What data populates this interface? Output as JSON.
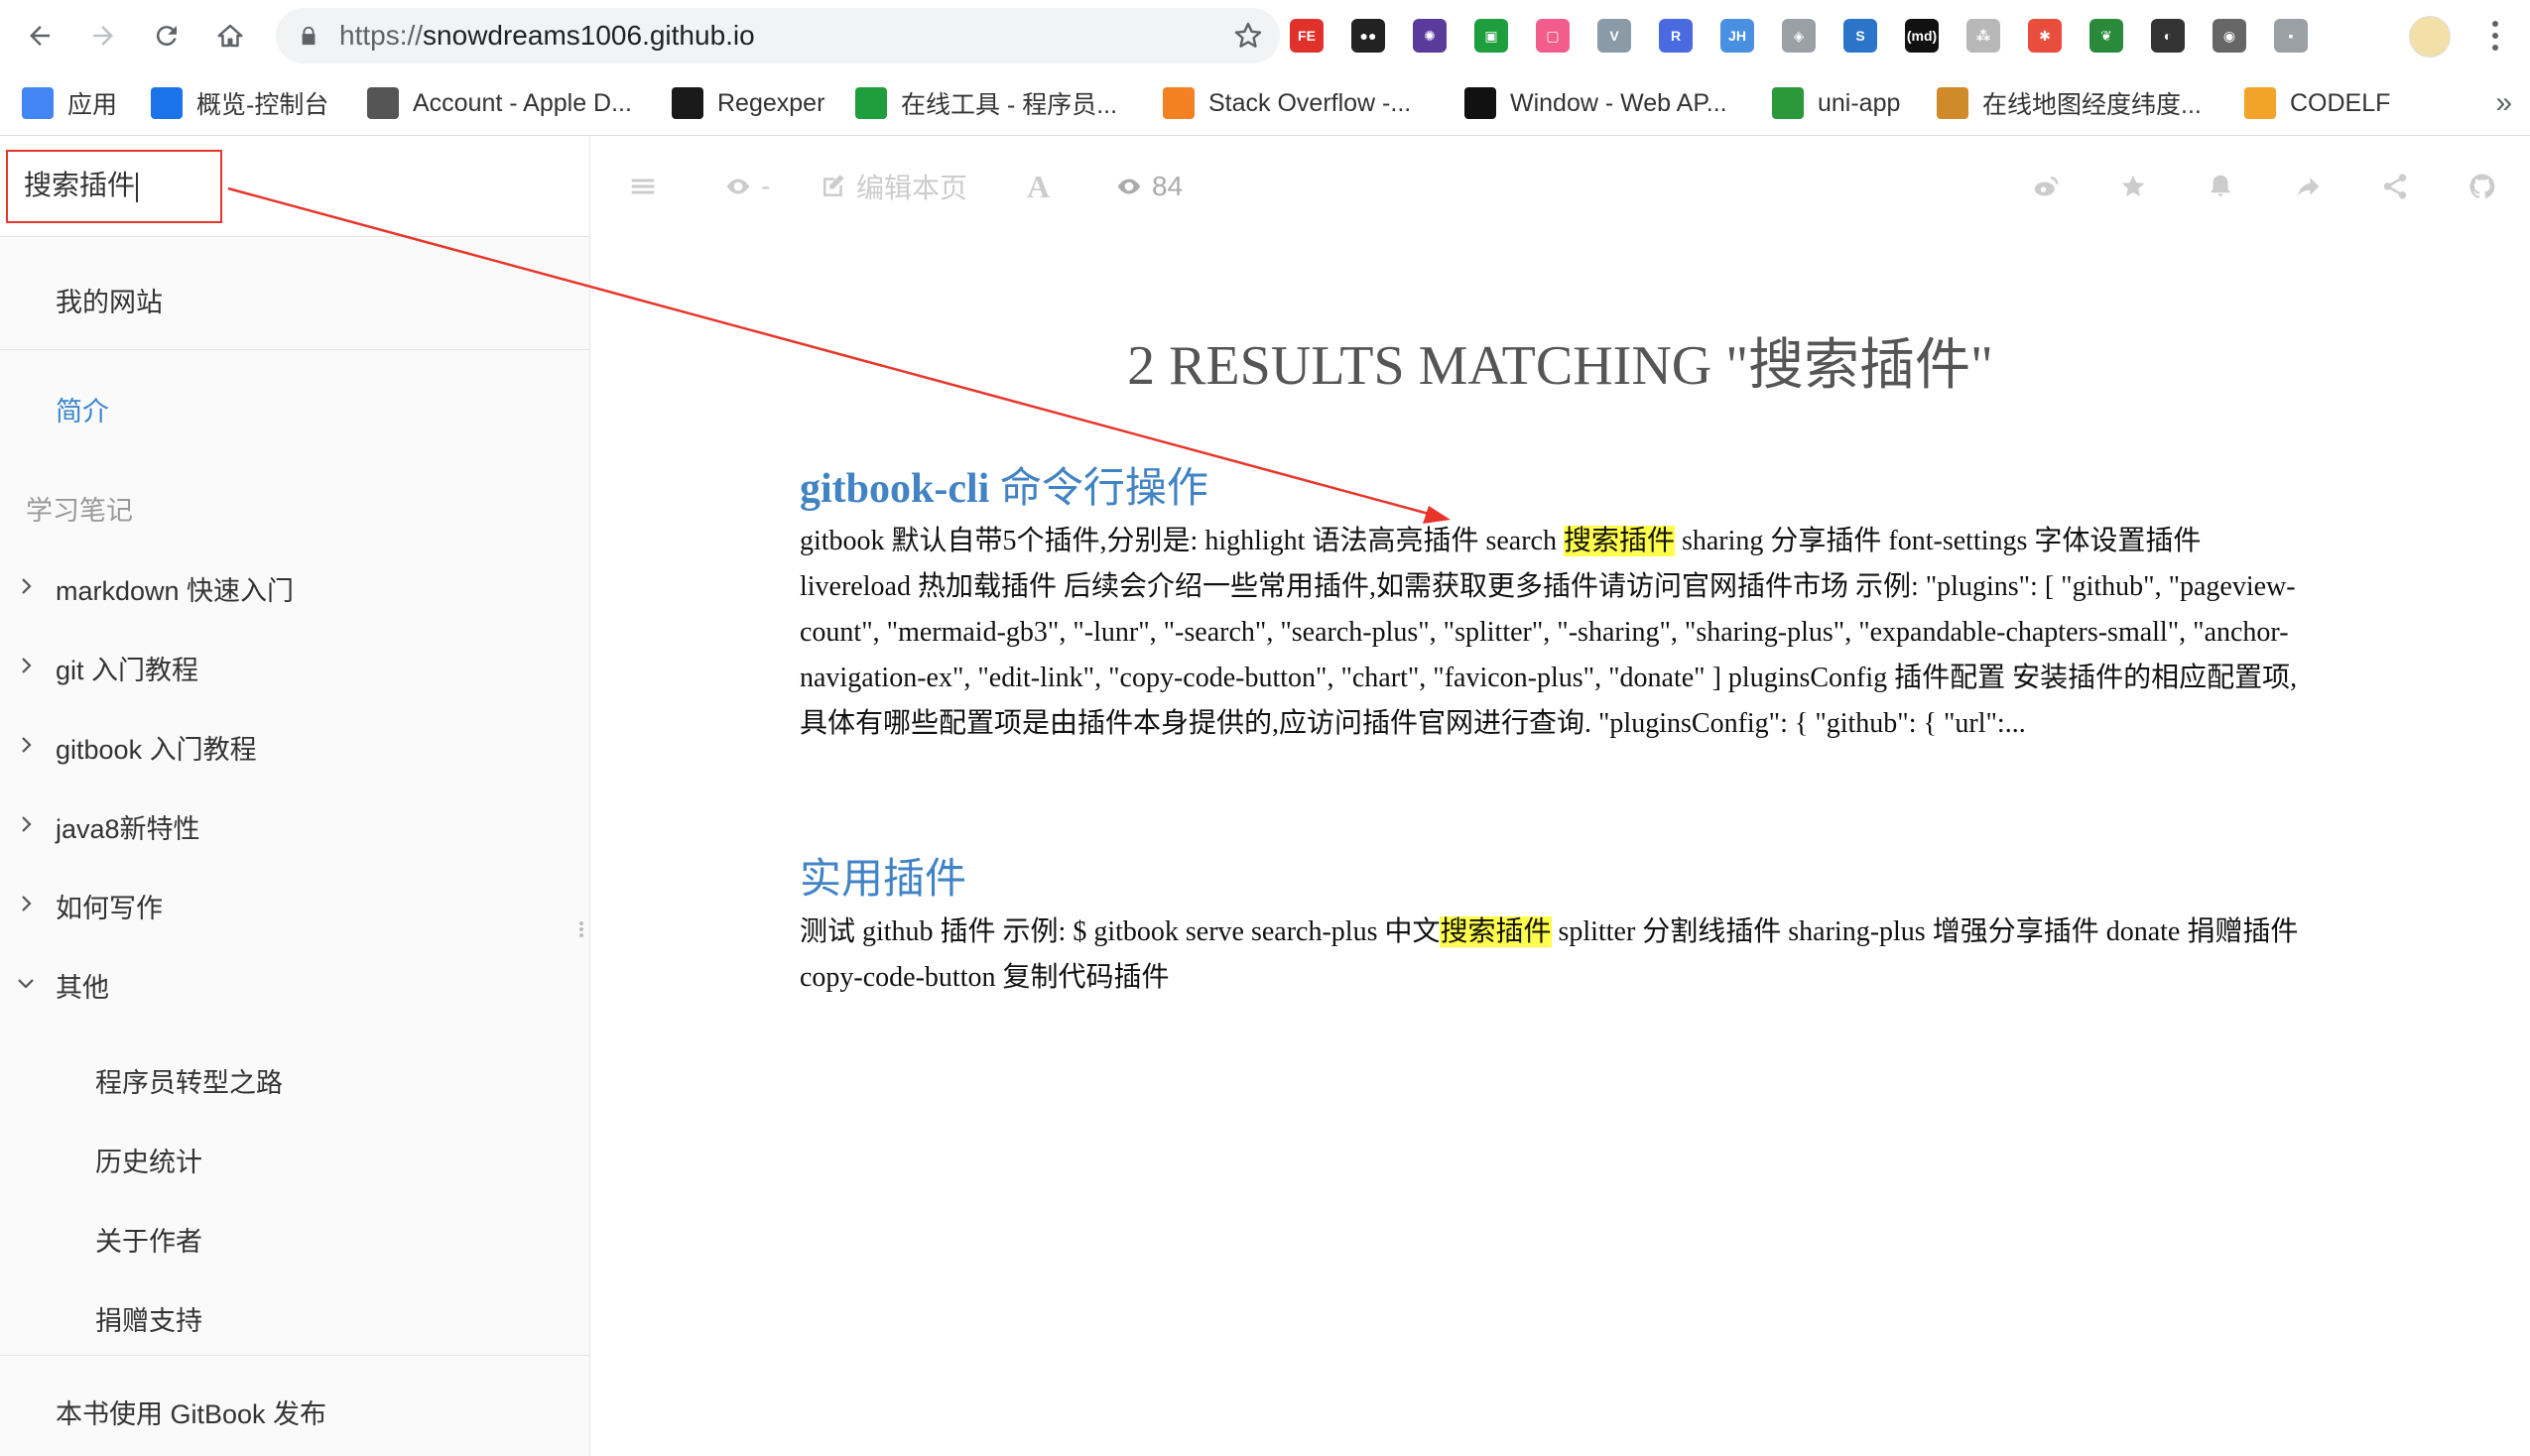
{
  "browser": {
    "url_scheme": "https://",
    "url_host": "snowdreams1006.github.io",
    "extensions": [
      {
        "name": "fe-helper-icon",
        "label": "FE",
        "color": "#e0312a"
      },
      {
        "name": "tampermonkey-icon",
        "label": "●●",
        "color": "#222"
      },
      {
        "name": "camera-shutter-icon",
        "label": "✺",
        "color": "#5a3a9a"
      },
      {
        "name": "green-square-icon",
        "label": "▣",
        "color": "#1e9e3c"
      },
      {
        "name": "bilibili-icon",
        "label": "▢",
        "color": "#f25d8e"
      },
      {
        "name": "vue-icon",
        "label": "V",
        "color": "#8a9aa7"
      },
      {
        "name": "r-hexagon-icon",
        "label": "R",
        "color": "#4a6be0"
      },
      {
        "name": "jh-icon",
        "label": "JH",
        "color": "#4a90e2"
      },
      {
        "name": "shield-ext-icon",
        "label": "◈",
        "color": "#9aa0a6"
      },
      {
        "name": "s-blue-icon",
        "label": "S",
        "color": "#2a74c9"
      },
      {
        "name": "md-icon",
        "label": "(md)",
        "color": "#111"
      },
      {
        "name": "tree-icon",
        "label": "⁂",
        "color": "#b8b8b8"
      },
      {
        "name": "pinwheel-icon",
        "label": "✱",
        "color": "#e84d3d"
      },
      {
        "name": "leaf-icon",
        "label": "❦",
        "color": "#2a8a3a"
      },
      {
        "name": "circle-dark-icon",
        "label": "◐",
        "color": "#333"
      },
      {
        "name": "github-octocat-icon",
        "label": "◉",
        "color": "#666"
      },
      {
        "name": "square-ext-icon",
        "label": "▪",
        "color": "#9aa0a6"
      }
    ],
    "bookmarks": [
      {
        "name": "bookmark-apps",
        "label": "应用",
        "icon": "apps-grid-icon",
        "color": "#4285f4"
      },
      {
        "name": "bookmark-aliyun",
        "label": "概览-控制台",
        "icon": "cloud-icon",
        "color": "#1a73e8"
      },
      {
        "name": "bookmark-apple",
        "label": "Account - Apple D...",
        "icon": "apple-icon",
        "color": "#555"
      },
      {
        "name": "bookmark-regexper",
        "label": "Regexper",
        "icon": "r-icon",
        "color": "#1a1a1a"
      },
      {
        "name": "bookmark-tools",
        "label": "在线工具 - 程序员...",
        "icon": "t-icon",
        "color": "#1e9e3c"
      },
      {
        "name": "bookmark-stackoverflow",
        "label": "Stack Overflow -...",
        "icon": "stack-icon",
        "color": "#f48024"
      },
      {
        "name": "bookmark-mdn",
        "label": "Window - Web AP...",
        "icon": "dino-icon",
        "color": "#111"
      },
      {
        "name": "bookmark-uniapp",
        "label": "uni-app",
        "icon": "u-icon",
        "color": "#2b9939"
      },
      {
        "name": "bookmark-map",
        "label": "在线地图经度纬度...",
        "icon": "map-icon",
        "color": "#d08a2a"
      },
      {
        "name": "bookmark-codelf",
        "label": "CODELF",
        "icon": "c-icon",
        "color": "#f2a32a"
      }
    ]
  },
  "sidebar": {
    "search_value": "搜索插件",
    "site_link": "我的网站",
    "intro": "简介",
    "section_header": "学习笔记",
    "chapters": [
      "markdown 快速入门",
      "git 入门教程",
      "gitbook 入门教程",
      "java8新特性",
      "如何写作",
      "其他"
    ],
    "sub_items": [
      "程序员转型之路",
      "历史统计",
      "关于作者",
      "捐赠支持"
    ],
    "footer": "本书使用 GitBook 发布"
  },
  "header": {
    "views_dash": "-",
    "edit_label": "编辑本页",
    "font_label": "A",
    "pageview_count": "84"
  },
  "search": {
    "title": "2 RESULTS MATCHING \"搜索插件\"",
    "results": [
      {
        "title_latin": "gitbook-cli",
        "title_cjk": " 命令行操作",
        "before": "gitbook 默认自带5个插件,分别是: highlight 语法高亮插件 search ",
        "highlight": "搜索插件",
        "after": " sharing 分享插件 font-settings 字体设置插件 livereload 热加载插件 后续会介绍一些常用插件,如需获取更多插件请访问官网插件市场 示例: \"plugins\": [ \"github\", \"pageview-count\", \"mermaid-gb3\", \"-lunr\", \"-search\", \"search-plus\", \"splitter\", \"-sharing\", \"sharing-plus\", \"expandable-chapters-small\", \"anchor-navigation-ex\", \"edit-link\", \"copy-code-button\", \"chart\", \"favicon-plus\", \"donate\" ] pluginsConfig 插件配置 安装插件的相应配置项,具体有哪些配置项是由插件本身提供的,应访问插件官网进行查询. \"pluginsConfig\": { \"github\": { \"url\":..."
      },
      {
        "title_latin": "",
        "title_cjk": "实用插件",
        "before": "测试 github 插件 示例: $ gitbook serve search-plus 中文",
        "highlight": "搜索插件",
        "after": " splitter 分割线插件 sharing-plus 增强分享插件 donate 捐赠插件 copy-code-button 复制代码插件"
      }
    ]
  }
}
